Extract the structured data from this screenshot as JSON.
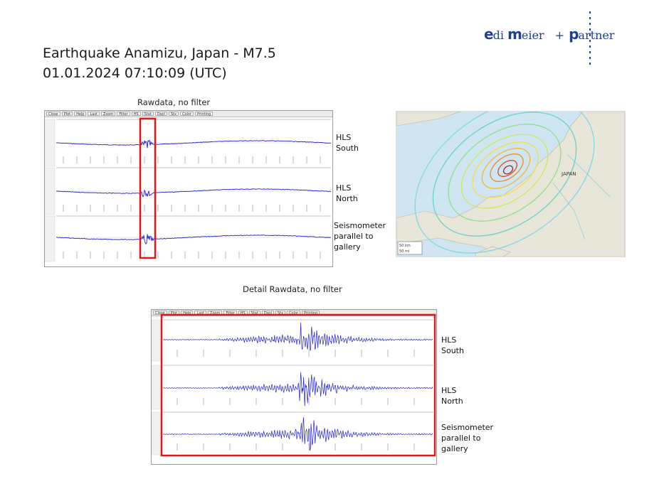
{
  "header": {
    "title_line1": "Earthquake Anamizu, Japan -  M7.5",
    "title_line2": "01.01.2024  07:10:09 (UTC)"
  },
  "logo": {
    "part1_initial": "e",
    "part1_rest": "di ",
    "part2_initial": "m",
    "part2_rest": "eier ",
    "plus": "+",
    "part3_initial": "p",
    "part3_rest": "artner"
  },
  "top_panel": {
    "caption": "Rawdata, no filter",
    "toolbar": [
      "Close",
      "Plot",
      "Help",
      "Last",
      "Zoom",
      "Filter",
      "HS",
      "Stat",
      "Dspl",
      "Stx",
      "Color",
      "Printing"
    ],
    "channels": [
      {
        "label_lines": [
          "HLS",
          "South"
        ]
      },
      {
        "label_lines": [
          "HLS",
          "North"
        ]
      },
      {
        "label_lines": [
          "Seismometer",
          "parallel to",
          "gallery"
        ]
      }
    ]
  },
  "bottom_panel": {
    "caption": "Detail Rawdata, no filter",
    "toolbar": [
      "Close",
      "Plot",
      "Help",
      "Last",
      "Zoom",
      "Filter",
      "HS",
      "Stat",
      "Dspl",
      "Stx",
      "Color",
      "Printing"
    ],
    "channels": [
      {
        "label_lines": [
          "HLS",
          "South"
        ]
      },
      {
        "label_lines": [
          "HLS",
          "North"
        ]
      },
      {
        "label_lines": [
          "Seismometer",
          "parallel to",
          "gallery"
        ]
      }
    ]
  },
  "map": {
    "country_label": "JAPAN",
    "scale_km": "50 km",
    "scale_mi": "50 mi"
  },
  "colors": {
    "trace": "#2222cc",
    "highlight": "#e0161b",
    "logo": "#1f3f8f"
  }
}
